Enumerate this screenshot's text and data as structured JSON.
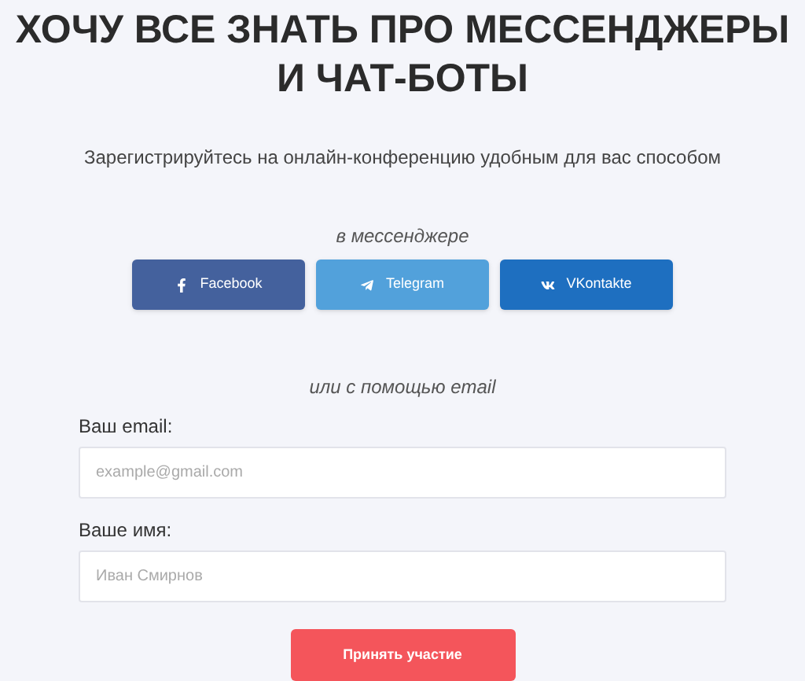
{
  "title_lines": [
    "ХОЧУ ВСЕ ЗНАТЬ ПРО МЕССЕНДЖЕРЫ",
    "И ЧАТ-БОТЫ"
  ],
  "subtitle": "Зарегистрируйтесь на онлайн-конференцию удобным для вас способом",
  "messenger_caption": "в мессенджере",
  "messenger_buttons": [
    {
      "kind": "facebook",
      "label": "Facebook",
      "color": "#44619d"
    },
    {
      "kind": "telegram",
      "label": "Telegram",
      "color": "#52a1db"
    },
    {
      "kind": "vk",
      "label": "VKontakte",
      "color": "#1e6fc0"
    }
  ],
  "email_caption": "или с помощью email",
  "fields": [
    {
      "label": "Ваш email:",
      "placeholder": "example@gmail.com"
    },
    {
      "label": "Ваше имя:",
      "placeholder": "Иван Смирнов"
    }
  ],
  "submit": "Принять участие"
}
